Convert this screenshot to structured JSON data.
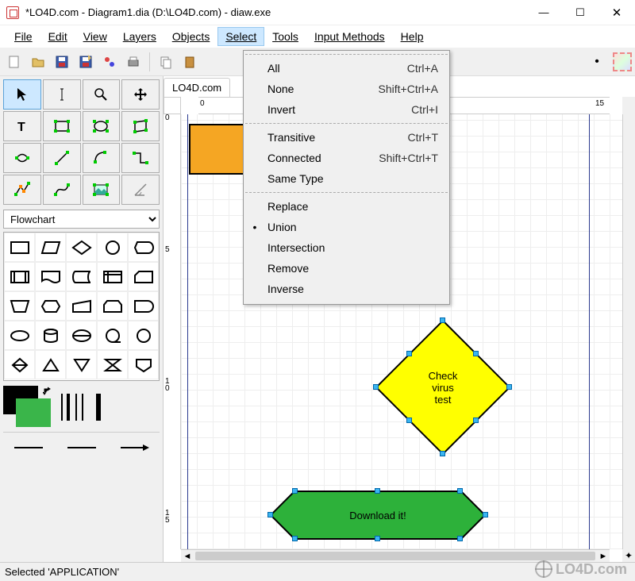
{
  "window": {
    "title": "*LO4D.com - Diagram1.dia (D:\\LO4D.com) - diaw.exe",
    "minimize": "—",
    "maximize": "☐",
    "close": "✕"
  },
  "menubar": {
    "file": "File",
    "edit": "Edit",
    "view": "View",
    "layers": "Layers",
    "objects": "Objects",
    "select": "Select",
    "tools": "Tools",
    "input_methods": "Input Methods",
    "help": "Help"
  },
  "toolbar": {
    "zoom_value": "",
    "icons": [
      "new",
      "open",
      "save",
      "saveas",
      "props",
      "print",
      "cut",
      "copy",
      "paste",
      "undo",
      "redo"
    ]
  },
  "dropdown": {
    "items": [
      {
        "label": "All",
        "accel": "Ctrl+A",
        "bullet": ""
      },
      {
        "label": "None",
        "accel": "Shift+Ctrl+A",
        "bullet": ""
      },
      {
        "label": "Invert",
        "accel": "Ctrl+I",
        "bullet": ""
      }
    ],
    "items2": [
      {
        "label": "Transitive",
        "accel": "Ctrl+T",
        "bullet": ""
      },
      {
        "label": "Connected",
        "accel": "Shift+Ctrl+T",
        "bullet": ""
      },
      {
        "label": "Same Type",
        "accel": "",
        "bullet": ""
      }
    ],
    "items3": [
      {
        "label": "Replace",
        "accel": "",
        "bullet": ""
      },
      {
        "label": "Union",
        "accel": "",
        "bullet": "•"
      },
      {
        "label": "Intersection",
        "accel": "",
        "bullet": ""
      },
      {
        "label": "Remove",
        "accel": "",
        "bullet": ""
      },
      {
        "label": "Inverse",
        "accel": "",
        "bullet": ""
      }
    ]
  },
  "left": {
    "shapeset": "Flowchart"
  },
  "doc": {
    "tab_label": "LO4D.com"
  },
  "ruler": {
    "h": {
      "l0": "0",
      "l1": "15"
    },
    "v": {
      "l0": "0",
      "l5": "5",
      "l10": "10",
      "l15": "15"
    }
  },
  "shapes": {
    "decision_text": "Check\nvirus\ntest",
    "terminator_text": "Download it!"
  },
  "status": {
    "text": "Selected 'APPLICATION'"
  },
  "watermark": {
    "text": "LO4D.com"
  }
}
